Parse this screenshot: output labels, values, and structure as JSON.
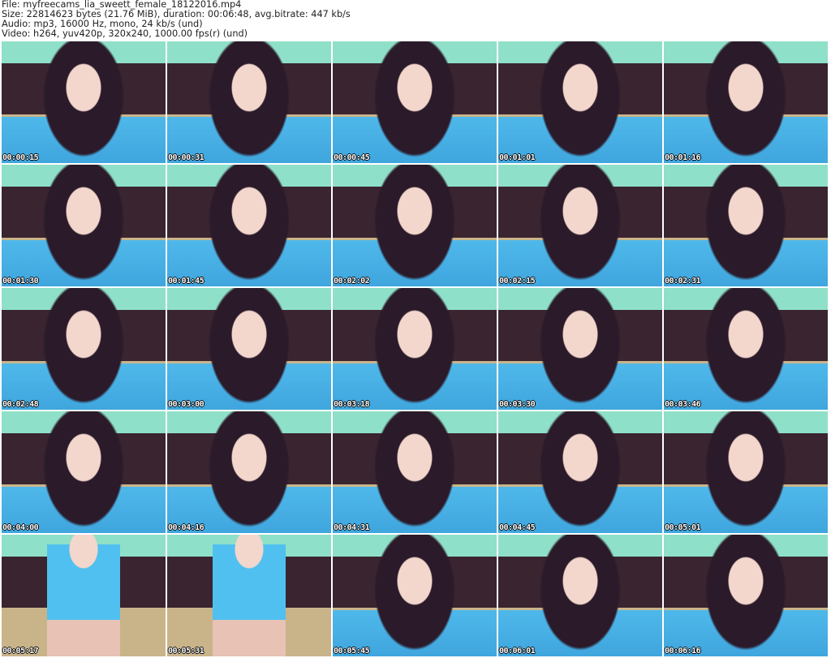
{
  "header": {
    "file": "File: myfreecams_lia_sweett_female_18122016.mp4",
    "size": "Size: 22814623 bytes (21.76 MiB), duration: 00:06:48, avg.bitrate: 447 kb/s",
    "audio": "Audio: mp3, 16000 Hz, mono, 24 kb/s (und)",
    "video": "Video: h264, yuv420p, 320x240, 1000.00 fps(r) (und)"
  },
  "thumbnails": [
    "00:00:15",
    "00:00:31",
    "00:00:45",
    "00:01:01",
    "00:01:16",
    "00:01:30",
    "00:01:45",
    "00:02:02",
    "00:02:15",
    "00:02:31",
    "00:02:48",
    "00:03:00",
    "00:03:18",
    "00:03:30",
    "00:03:46",
    "00:04:00",
    "00:04:16",
    "00:04:31",
    "00:04:45",
    "00:05:01",
    "00:05:17",
    "00:05:31",
    "00:05:45",
    "00:06:01",
    "00:06:16"
  ]
}
